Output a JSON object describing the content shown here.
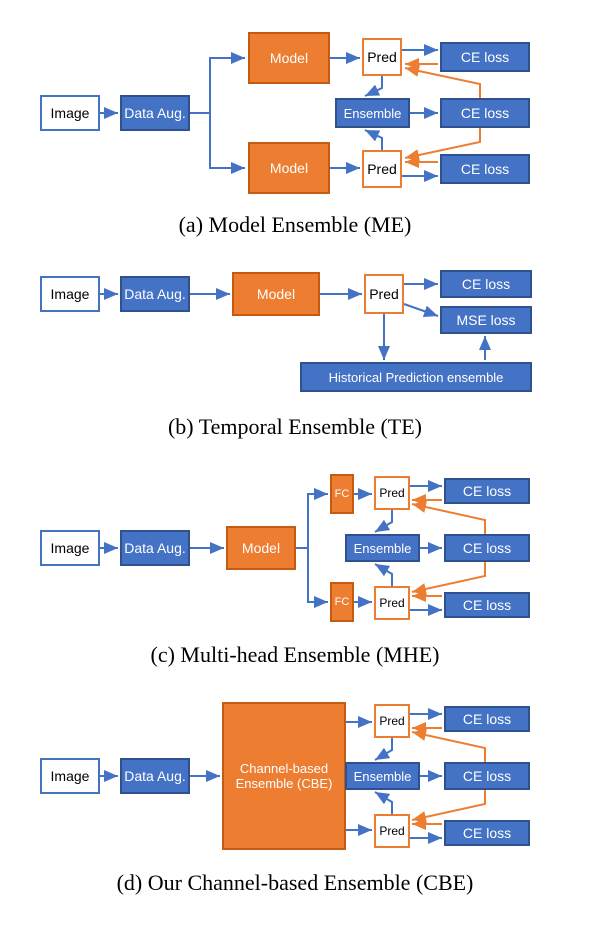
{
  "figureA": {
    "image": "Image",
    "dataAug": "Data Aug.",
    "model1": "Model",
    "model2": "Model",
    "pred1": "Pred",
    "pred2": "Pred",
    "ensemble": "Ensemble",
    "ce1": "CE loss",
    "ce2": "CE loss",
    "ce3": "CE loss",
    "caption": "(a) Model Ensemble (ME)"
  },
  "figureB": {
    "image": "Image",
    "dataAug": "Data Aug.",
    "model": "Model",
    "pred": "Pred",
    "ce": "CE loss",
    "mse": "MSE loss",
    "historical": "Historical Prediction ensemble",
    "caption": "(b) Temporal Ensemble (TE)"
  },
  "figureC": {
    "image": "Image",
    "dataAug": "Data Aug.",
    "model": "Model",
    "fc1": "FC",
    "fc2": "FC",
    "pred1": "Pred",
    "pred2": "Pred",
    "ensemble": "Ensemble",
    "ce1": "CE loss",
    "ce2": "CE loss",
    "ce3": "CE loss",
    "caption": "(c) Multi-head Ensemble (MHE)"
  },
  "figureD": {
    "image": "Image",
    "dataAug": "Data Aug.",
    "cbe": "Channel-based Ensemble (CBE)",
    "pred1": "Pred",
    "pred2": "Pred",
    "ensemble": "Ensemble",
    "ce1": "CE loss",
    "ce2": "CE loss",
    "ce3": "CE loss",
    "caption": "(d) Our Channel-based Ensemble (CBE)"
  },
  "chart_data": {
    "type": "diagram",
    "subfigures": [
      {
        "id": "a",
        "title": "Model Ensemble (ME)",
        "nodes": [
          "Image",
          "Data Aug.",
          "Model",
          "Model",
          "Pred",
          "Pred",
          "Ensemble",
          "CE loss",
          "CE loss",
          "CE loss"
        ],
        "flow": "Image -> Data Aug. -> (Model, Model) -> (Pred, Pred) -> Ensemble; Pred1->CE loss; Pred2->CE loss; Ensemble->CE loss; feedback CE loss->Pred (orange)"
      },
      {
        "id": "b",
        "title": "Temporal Ensemble (TE)",
        "nodes": [
          "Image",
          "Data Aug.",
          "Model",
          "Pred",
          "CE loss",
          "MSE loss",
          "Historical Prediction ensemble"
        ],
        "flow": "Image -> Data Aug. -> Model -> Pred -> CE loss; Pred -> MSE loss; Pred -> Historical Prediction ensemble -> MSE loss"
      },
      {
        "id": "c",
        "title": "Multi-head Ensemble (MHE)",
        "nodes": [
          "Image",
          "Data Aug.",
          "Model",
          "FC",
          "FC",
          "Pred",
          "Pred",
          "Ensemble",
          "CE loss",
          "CE loss",
          "CE loss"
        ],
        "flow": "Image -> Data Aug. -> Model -> (FC, FC) -> (Pred, Pred) -> Ensemble; Pred->CE loss; Ensemble->CE loss; feedback orange"
      },
      {
        "id": "d",
        "title": "Our Channel-based Ensemble (CBE)",
        "nodes": [
          "Image",
          "Data Aug.",
          "Channel-based Ensemble (CBE)",
          "Pred",
          "Pred",
          "Ensemble",
          "CE loss",
          "CE loss",
          "CE loss"
        ],
        "flow": "Image -> Data Aug. -> CBE -> (Pred, Pred) -> Ensemble; Pred->CE loss; Ensemble->CE loss; feedback orange"
      }
    ]
  }
}
